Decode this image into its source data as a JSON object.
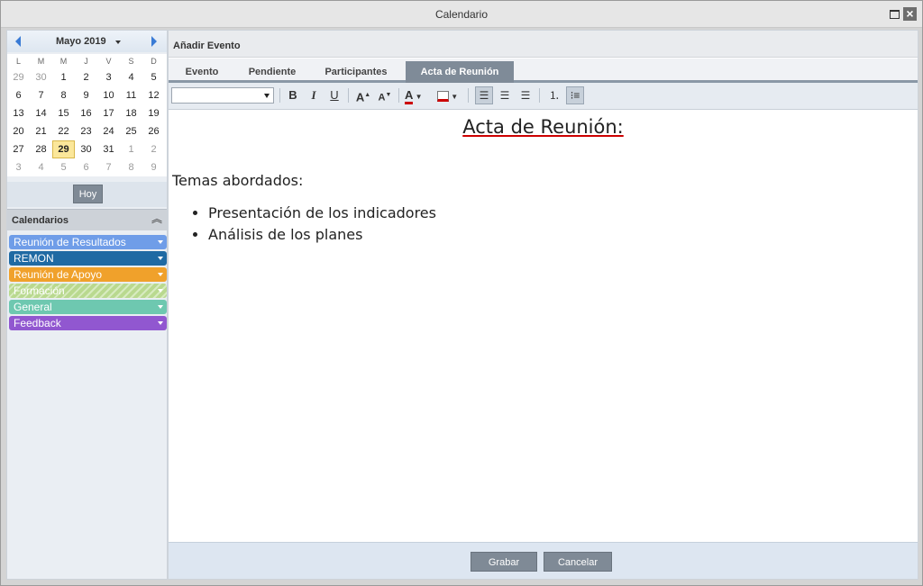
{
  "window": {
    "title": "Calendario"
  },
  "calendar": {
    "month_label": "Mayo 2019",
    "weekdays": [
      "L",
      "M",
      "M",
      "J",
      "V",
      "S",
      "D"
    ],
    "weeks": [
      [
        {
          "d": "29",
          "o": true
        },
        {
          "d": "30",
          "o": true
        },
        {
          "d": "1"
        },
        {
          "d": "2"
        },
        {
          "d": "3"
        },
        {
          "d": "4"
        },
        {
          "d": "5"
        }
      ],
      [
        {
          "d": "6"
        },
        {
          "d": "7"
        },
        {
          "d": "8"
        },
        {
          "d": "9"
        },
        {
          "d": "10"
        },
        {
          "d": "11"
        },
        {
          "d": "12"
        }
      ],
      [
        {
          "d": "13"
        },
        {
          "d": "14"
        },
        {
          "d": "15"
        },
        {
          "d": "16"
        },
        {
          "d": "17"
        },
        {
          "d": "18"
        },
        {
          "d": "19"
        }
      ],
      [
        {
          "d": "20"
        },
        {
          "d": "21"
        },
        {
          "d": "22"
        },
        {
          "d": "23"
        },
        {
          "d": "24"
        },
        {
          "d": "25"
        },
        {
          "d": "26"
        }
      ],
      [
        {
          "d": "27"
        },
        {
          "d": "28"
        },
        {
          "d": "29",
          "t": true
        },
        {
          "d": "30"
        },
        {
          "d": "31"
        },
        {
          "d": "1",
          "o": true
        },
        {
          "d": "2",
          "o": true
        }
      ],
      [
        {
          "d": "3",
          "o": true
        },
        {
          "d": "4",
          "o": true
        },
        {
          "d": "5",
          "o": true
        },
        {
          "d": "6",
          "o": true
        },
        {
          "d": "7",
          "o": true
        },
        {
          "d": "8",
          "o": true
        },
        {
          "d": "9",
          "o": true
        }
      ]
    ],
    "today_label": "Hoy"
  },
  "calendars": {
    "title": "Calendarios",
    "items": [
      {
        "label": "Reunión de Resultados",
        "color": "#6f9de8"
      },
      {
        "label": "REMON",
        "color": "#1f6aa3"
      },
      {
        "label": "Reunión de Apoyo",
        "color": "#f0a12b"
      },
      {
        "label": "Formación",
        "color": "#b9d98f",
        "hatched": true
      },
      {
        "label": "General",
        "color": "#6ec8b0"
      },
      {
        "label": "Feedback",
        "color": "#9157d0"
      }
    ]
  },
  "panel": {
    "title": "Añadir Evento"
  },
  "tabs": [
    {
      "label": "Evento",
      "active": false
    },
    {
      "label": "Pendiente",
      "active": false
    },
    {
      "label": "Participantes",
      "active": false
    },
    {
      "label": "Acta de Reunión",
      "active": true
    }
  ],
  "toolbar": {
    "font_value": "",
    "bold": "B",
    "italic": "I",
    "underline": "U",
    "grow": "A",
    "shrink": "A",
    "font_color": "A"
  },
  "editor": {
    "heading": "Acta de Reunión:",
    "paragraph": "Temas abordados:",
    "bullets": [
      "Presentación de los indicadores",
      "Análisis de los planes"
    ]
  },
  "footer": {
    "save_label": "Grabar",
    "cancel_label": "Cancelar"
  }
}
